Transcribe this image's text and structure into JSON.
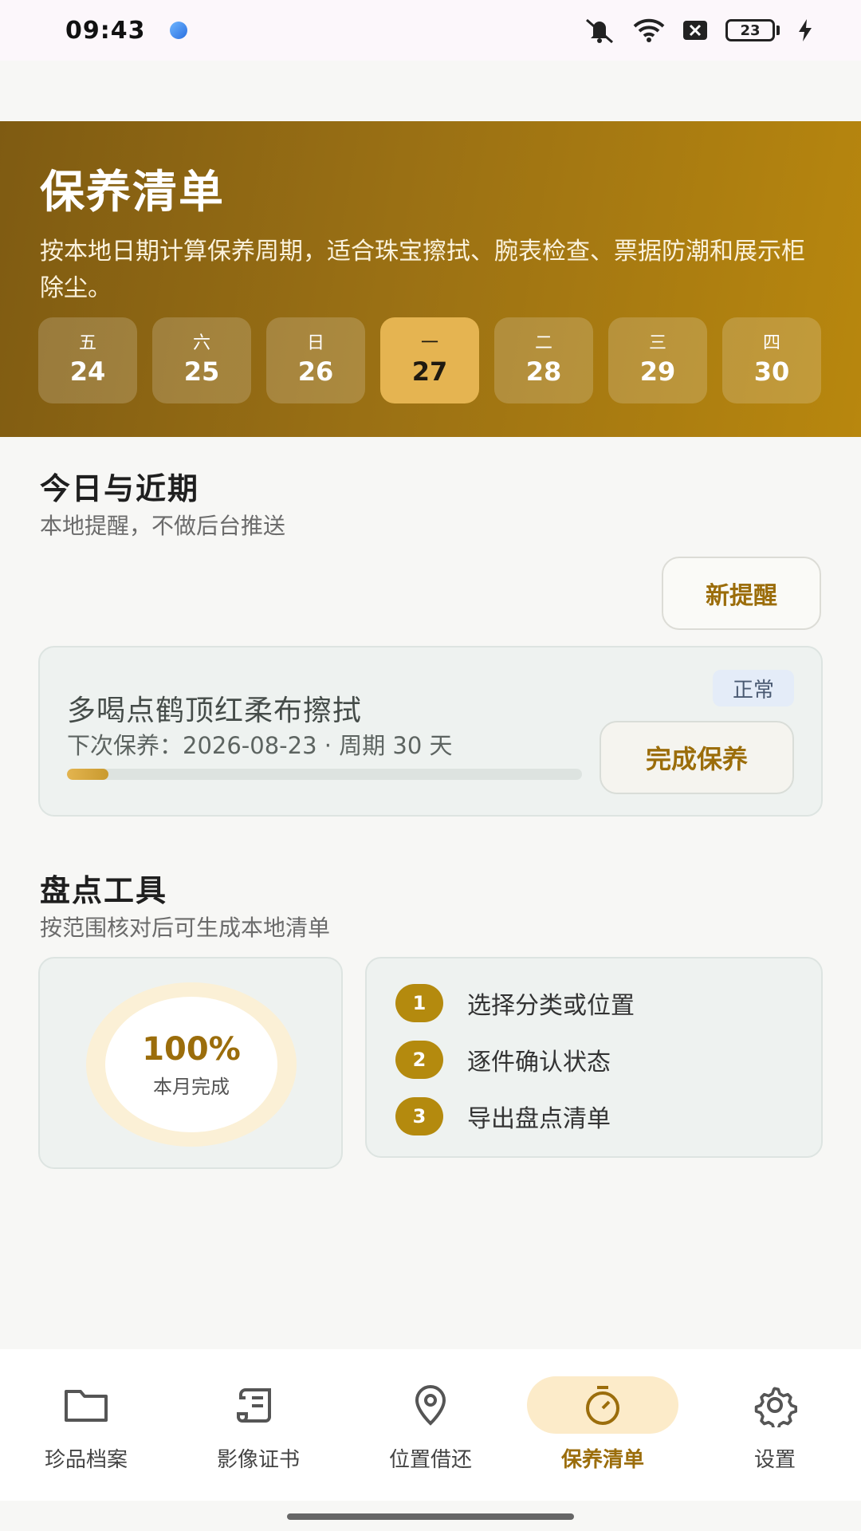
{
  "status_bar": {
    "time": "09:43",
    "battery": "23"
  },
  "header": {
    "title": "保养清单",
    "description": "按本地日期计算保养周期，适合珠宝擦拭、腕表检查、票据防潮和展示柜除尘。",
    "days": [
      {
        "weekday": "五",
        "date": "24"
      },
      {
        "weekday": "六",
        "date": "25"
      },
      {
        "weekday": "日",
        "date": "26"
      },
      {
        "weekday": "一",
        "date": "27"
      },
      {
        "weekday": "二",
        "date": "28"
      },
      {
        "weekday": "三",
        "date": "29"
      },
      {
        "weekday": "四",
        "date": "30"
      }
    ],
    "selected_day_index": 3
  },
  "today": {
    "title": "今日与近期",
    "subtitle": "本地提醒，不做后台推送",
    "new_button": "新提醒",
    "reminder": {
      "title": "多喝点鹤顶红柔布擦拭",
      "meta": "下次保养：2026-08-23 · 周期 30 天",
      "status": "正常",
      "progress": 0.08,
      "action": "完成保养"
    }
  },
  "inventory": {
    "title": "盘点工具",
    "subtitle": "按范围核对后可生成本地清单",
    "completion": "100%",
    "completion_label": "本月完成",
    "steps": [
      {
        "num": "1",
        "text": "选择分类或位置"
      },
      {
        "num": "2",
        "text": "逐件确认状态"
      },
      {
        "num": "3",
        "text": "导出盘点清单"
      }
    ]
  },
  "nav": {
    "items": [
      {
        "label": "珍品档案",
        "icon": "folder-icon"
      },
      {
        "label": "影像证书",
        "icon": "scroll-icon"
      },
      {
        "label": "位置借还",
        "icon": "location-pin-icon"
      },
      {
        "label": "保养清单",
        "icon": "timer-icon"
      },
      {
        "label": "设置",
        "icon": "gear-icon"
      }
    ],
    "active_index": 3
  },
  "colors": {
    "accent": "#9b6d0b",
    "hero_start": "#7f5b12",
    "hero_end": "#b8870e",
    "active_day": "#e5b451"
  }
}
